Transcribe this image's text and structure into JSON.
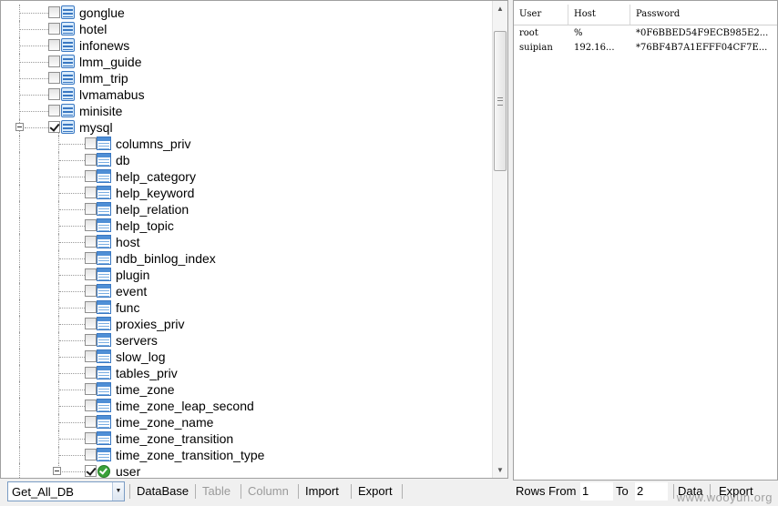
{
  "tree": {
    "databases_before": [
      "gonglue",
      "hotel",
      "infonews",
      "lmm_guide",
      "lmm_trip",
      "lvmamabus",
      "minisite"
    ],
    "expanded_db": "mysql",
    "tables": [
      "columns_priv",
      "db",
      "help_category",
      "help_keyword",
      "help_relation",
      "help_topic",
      "host",
      "ndb_binlog_index",
      "plugin",
      "event",
      "func",
      "proxies_priv",
      "servers",
      "slow_log",
      "tables_priv",
      "time_zone",
      "time_zone_leap_second",
      "time_zone_name",
      "time_zone_transition",
      "time_zone_transition_type"
    ],
    "selected_table": "user"
  },
  "grid": {
    "columns": [
      "User",
      "Host",
      "Password"
    ],
    "rows": [
      [
        "root",
        "%",
        "*0F6BBED54F9ECB985E2..."
      ],
      [
        "suipian",
        "192.16...",
        "*76BF4B7A1EFFF04CF7E..."
      ]
    ]
  },
  "toolbar": {
    "db_select_value": "Get_All_DB",
    "buttons": [
      {
        "label": "DataBase",
        "enabled": true
      },
      {
        "label": "Table",
        "enabled": false
      },
      {
        "label": "Column",
        "enabled": false
      },
      {
        "label": "Import",
        "enabled": true
      },
      {
        "label": "Export",
        "enabled": true
      }
    ]
  },
  "paging": {
    "rows_from_label": "Rows From",
    "rows_from_value": "1",
    "to_label": "To",
    "to_value": "2",
    "data_label": "Data",
    "export_label": "Export"
  },
  "watermark": "www.wooyun.org"
}
